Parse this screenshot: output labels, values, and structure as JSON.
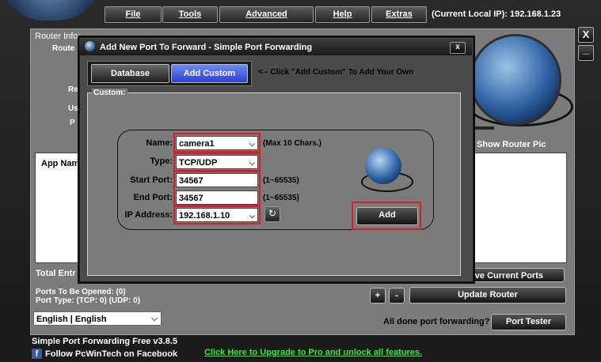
{
  "menu": {
    "items": [
      "File",
      "Tools",
      "Advanced",
      "Help",
      "Extras"
    ],
    "local_ip": "(Current Local IP): 192.168.1.23"
  },
  "window_controls": {
    "close": "X",
    "minimize": "_"
  },
  "main": {
    "router_info_label": "Router Info:",
    "router_info_fields": [
      "Route",
      "Re",
      "Us",
      "P"
    ],
    "show_router_pic": "Show Router Pic",
    "app_name_header": "App Nam",
    "total_entries": "Total Entr",
    "remove_current_ports": "ove Current Ports",
    "ports_to_be_opened": "Ports To Be Opened: (0)",
    "port_type": "Port Type: (TCP: 0) (UDP: 0)",
    "plus": "+",
    "minus": "-",
    "update_router": "Update Router",
    "language": "English | English",
    "all_done": "All done port forwarding?",
    "port_tester": "Port Tester",
    "version": "Simple Port Forwarding Free v3.8.5",
    "follow_facebook": "Follow PcWinTech on Facebook",
    "upgrade_link": "Click Here to Upgrade to Pro and unlock all features."
  },
  "dialog": {
    "title": "Add New Port To Forward - Simple Port Forwarding",
    "close": "x",
    "tabs": [
      "Database",
      "Add Custom"
    ],
    "active_tab": "Add Custom",
    "hint": "<-- Click \"Add Custom\" To Add Your Own",
    "group_label": "Custom:",
    "fields": {
      "name": {
        "label": "Name:",
        "value": "camera1",
        "note": "(Max 10 Chars.)"
      },
      "type": {
        "label": "Type:",
        "value": "TCP/UDP"
      },
      "start_port": {
        "label": "Start Port:",
        "value": "34567",
        "note": "(1~65535)"
      },
      "end_port": {
        "label": "End Port:",
        "value": "34567",
        "note": "(1~65535)"
      },
      "ip_address": {
        "label": "IP Address:",
        "value": "192.168.1.10"
      }
    },
    "add_button": "Add"
  },
  "colors": {
    "highlight": "#d4202a",
    "active_tab": "#3b52e0",
    "upgrade_link": "#2ef02e"
  },
  "icons": [
    "globe-logo-icon",
    "router-globe-icon",
    "facebook-icon",
    "refresh-icon",
    "chevron-down-icon"
  ]
}
